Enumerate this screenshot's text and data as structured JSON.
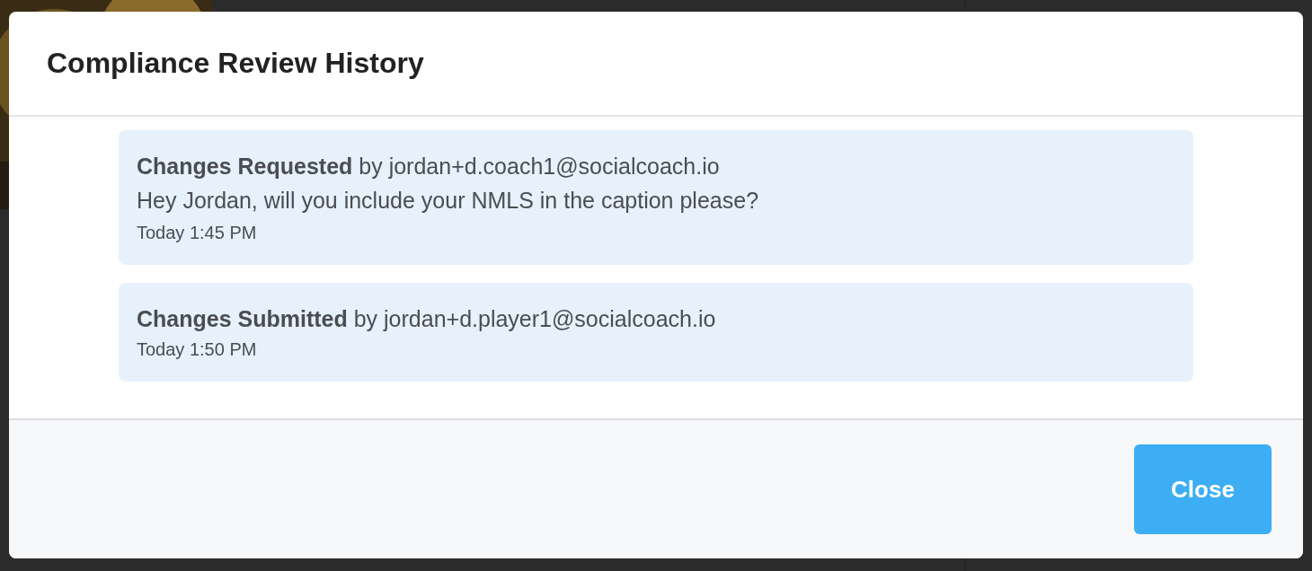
{
  "dialog": {
    "title": "Compliance Review History",
    "entries": [
      {
        "status": "Changes Requested",
        "author": "by jordan+d.coach1@socialcoach.io",
        "message": "Hey Jordan, will you include your NMLS in the caption please?",
        "time": "Today 1:45 PM"
      },
      {
        "status": "Changes Submitted",
        "author": "by jordan+d.player1@socialcoach.io",
        "time": "Today 1:50 PM"
      }
    ],
    "buttons": [
      "Close"
    ]
  }
}
